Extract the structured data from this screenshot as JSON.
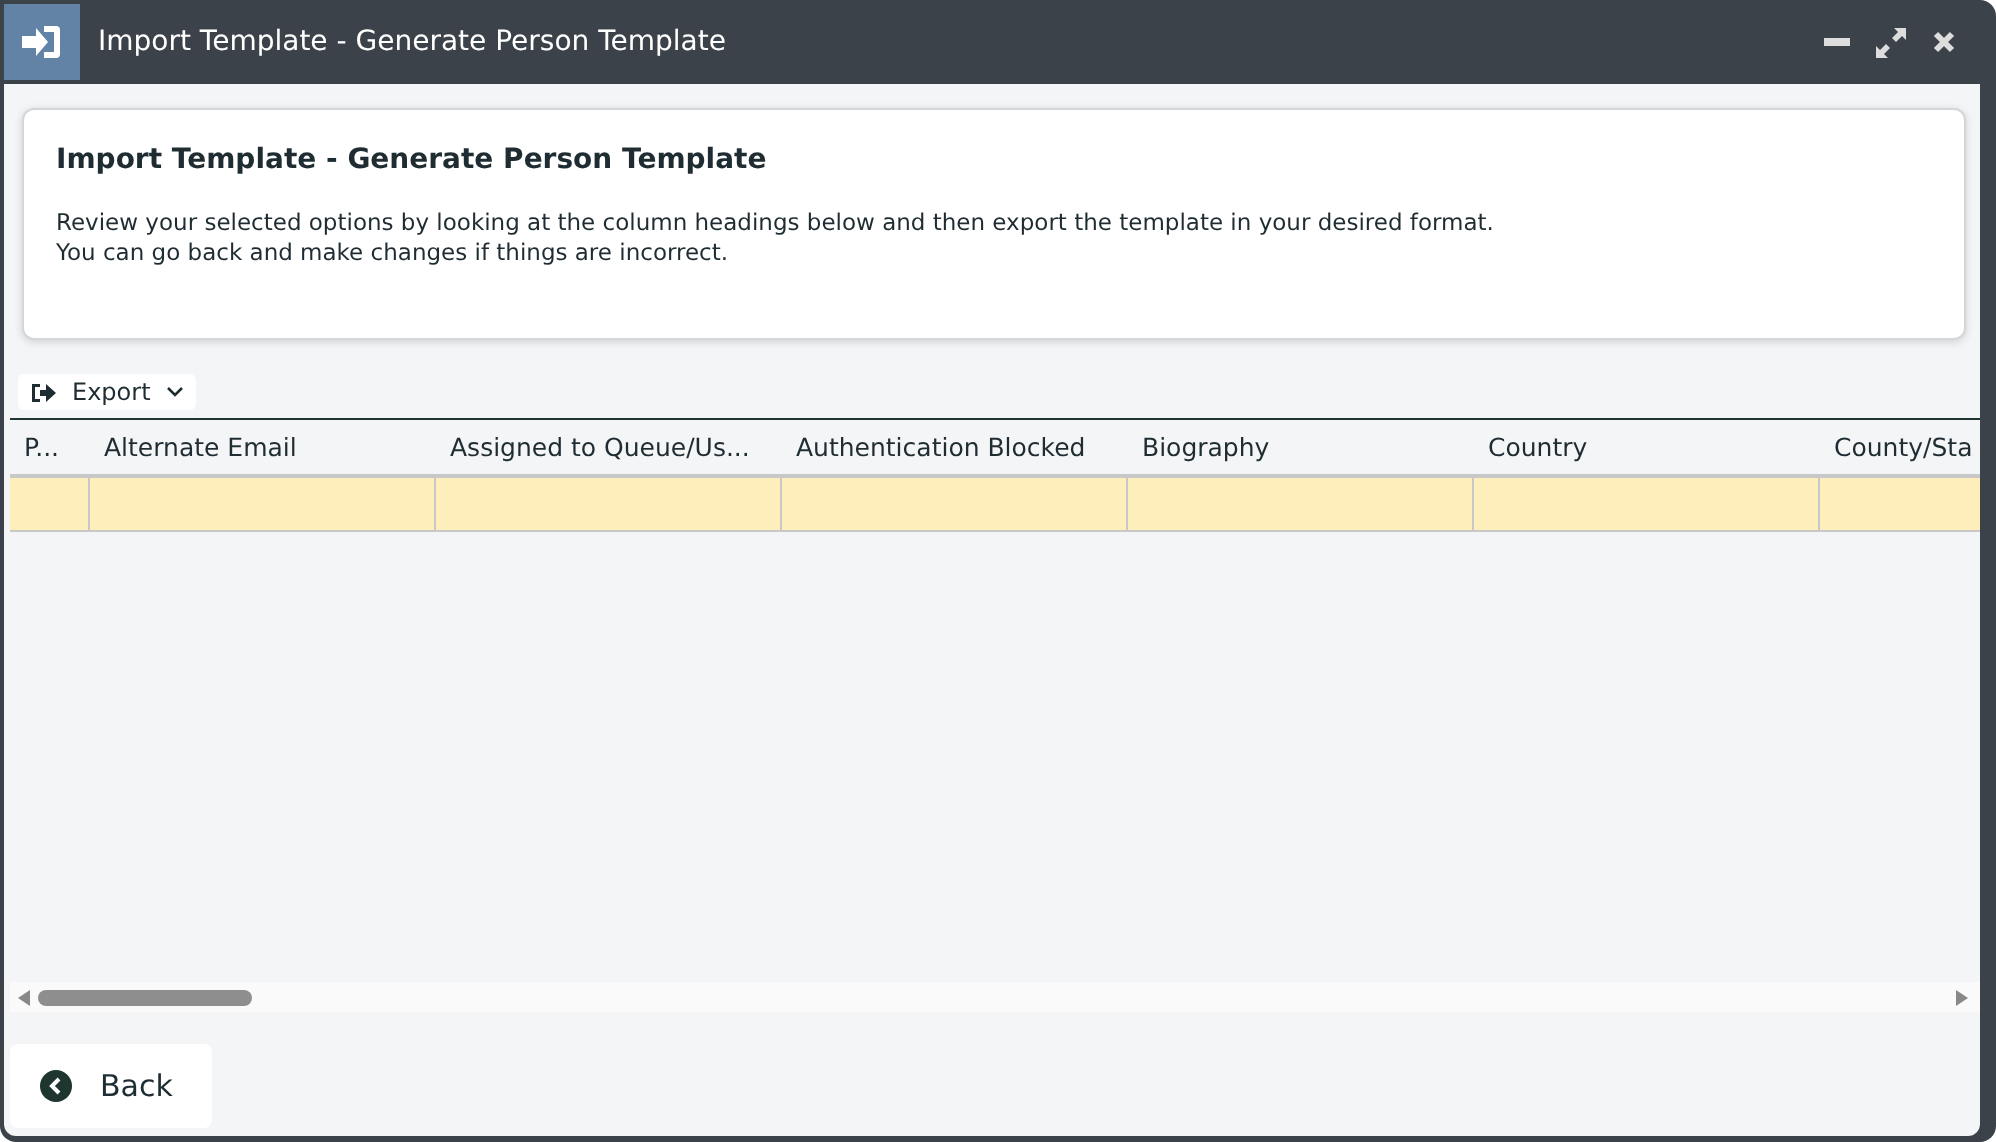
{
  "window": {
    "title": "Import Template - Generate Person Template"
  },
  "panel": {
    "heading": "Import Template - Generate Person Template",
    "lines": [
      "Review your selected options by looking at the column headings below and then export the template in your desired format.",
      "You can go back and make changes if things are incorrect."
    ]
  },
  "toolbar": {
    "export_label": "Export"
  },
  "table": {
    "columns": [
      "P...",
      "Alternate Email",
      "Assigned to Queue/Us...",
      "Authentication Blocked",
      "Biography",
      "Country",
      "County/Sta"
    ],
    "rows": [
      {
        "selected": true
      }
    ]
  },
  "back_button": {
    "label": "Back"
  }
}
